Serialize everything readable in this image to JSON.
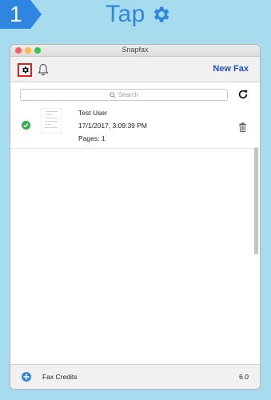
{
  "step": {
    "number": "1",
    "title": "Tap",
    "title_icon": "gear-icon",
    "accent": "#2f86e0"
  },
  "window": {
    "title": "Snapfax",
    "toolbar": {
      "settings_icon": "gear-icon",
      "bell_icon": "bell-icon",
      "new_fax_label": "New Fax"
    },
    "search": {
      "placeholder": "Search"
    },
    "faxes": [
      {
        "name": "Test User",
        "timestamp": "17/1/2017, 3:09:39 PM",
        "pages": "Pages: 1",
        "status": "sent"
      }
    ],
    "footer": {
      "credits_label": "Fax Credits",
      "credits_value": "6.0"
    }
  },
  "colors": {
    "background": "#a7dcee",
    "highlight": "#e0201a",
    "link": "#1f4fe0",
    "success": "#2bb24c"
  }
}
